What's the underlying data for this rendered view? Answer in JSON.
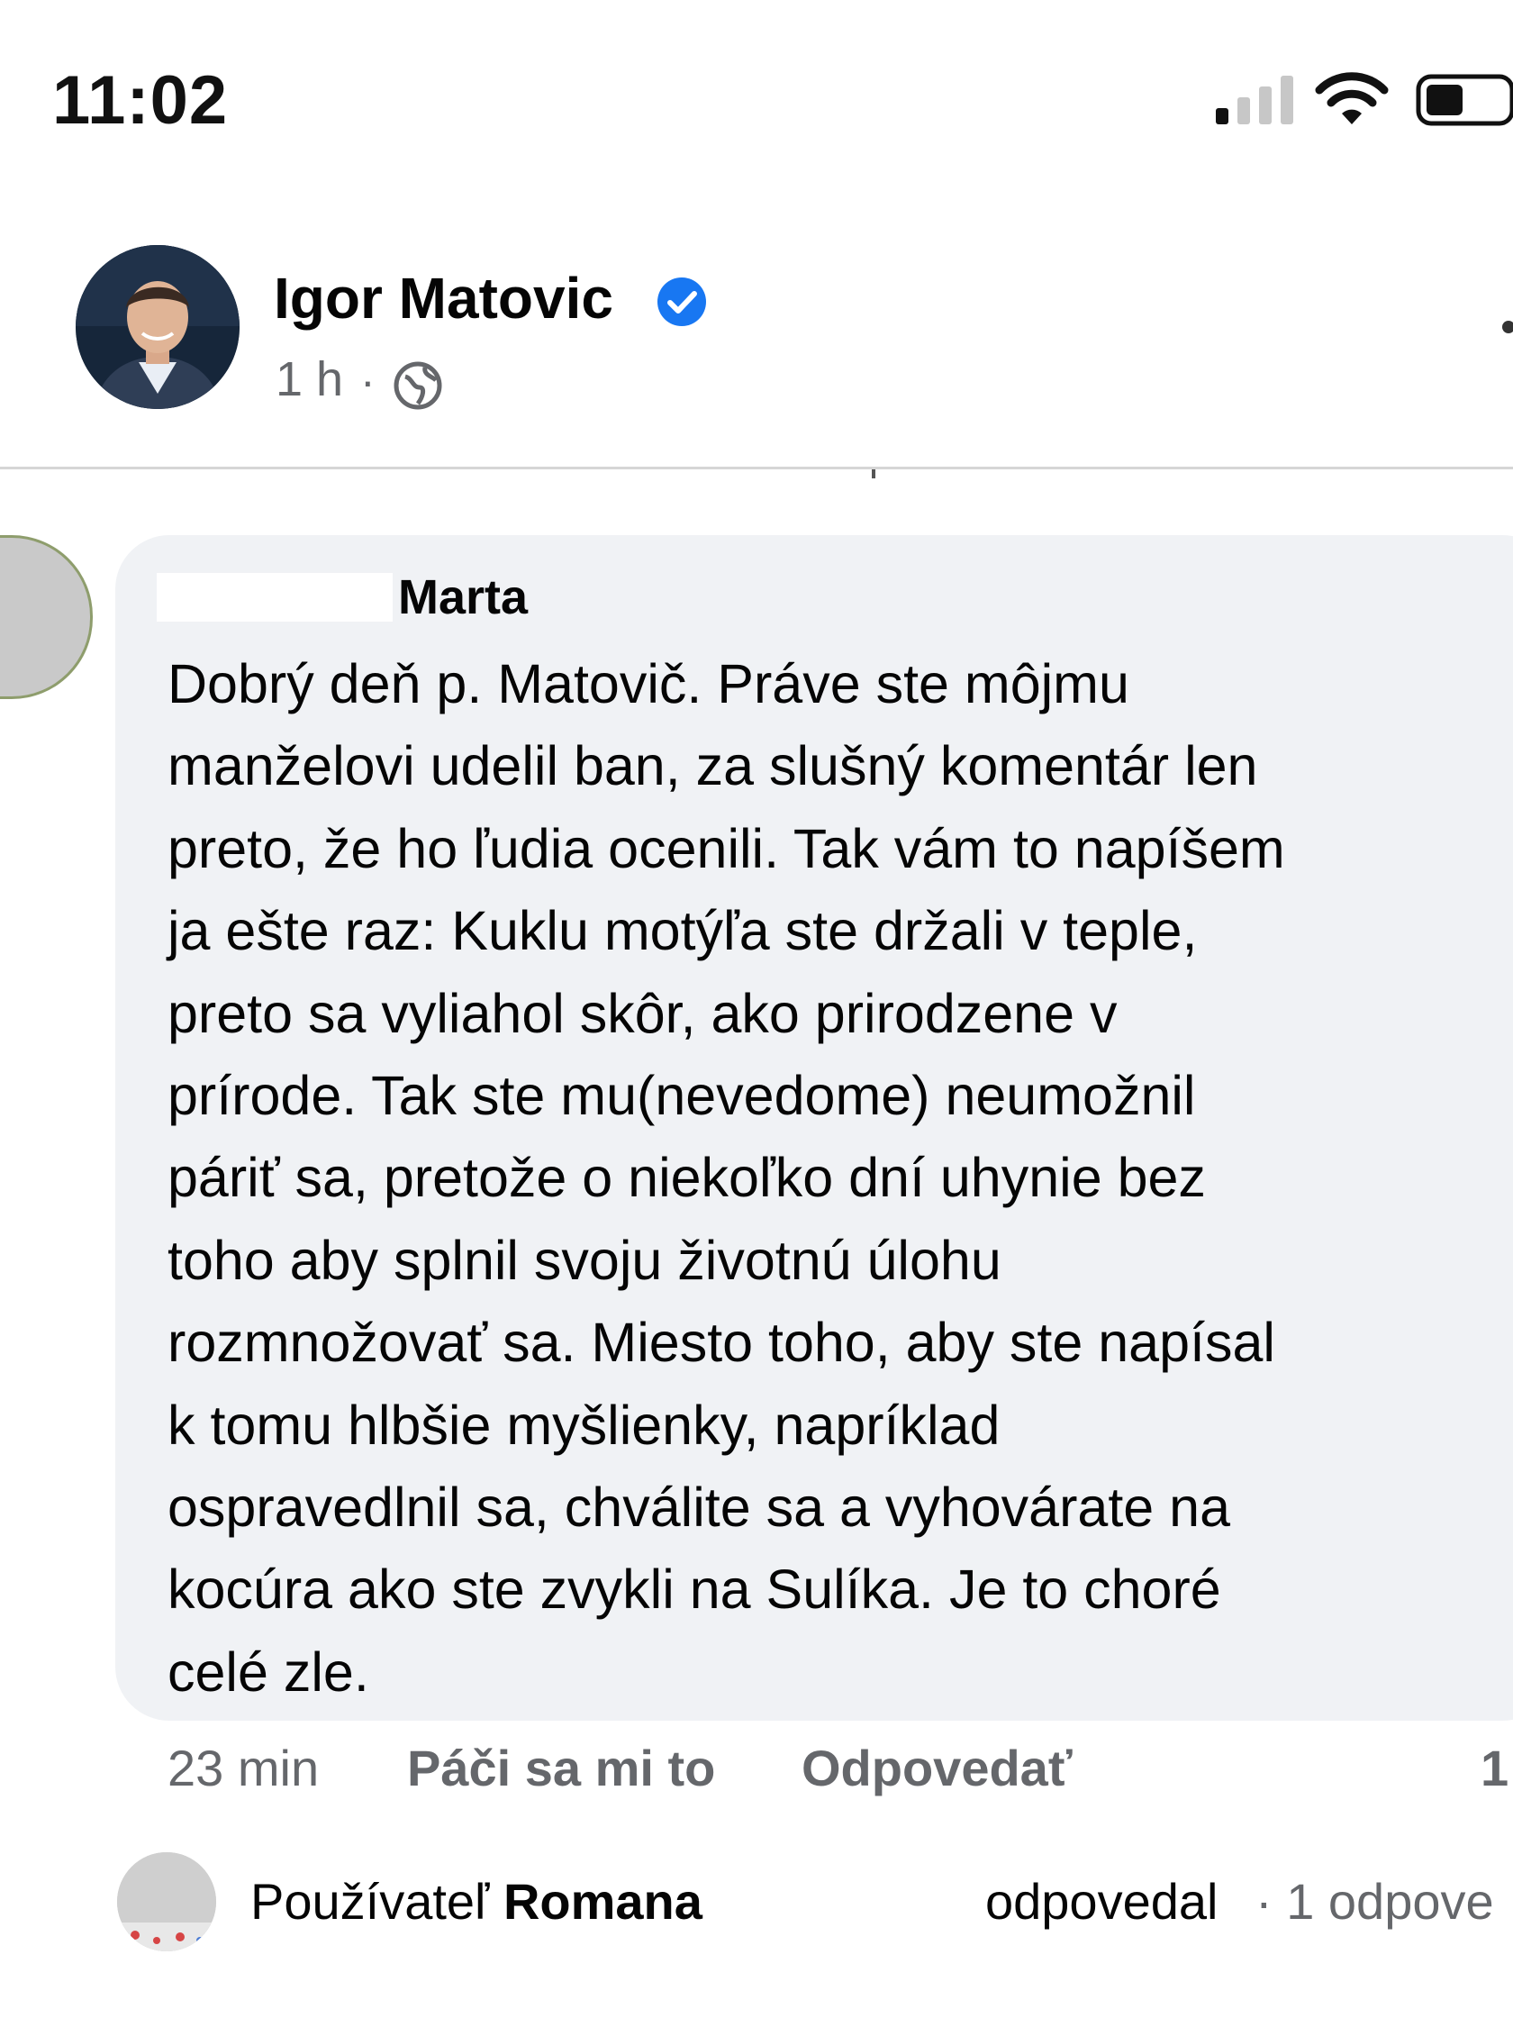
{
  "status_bar": {
    "time": "11:02"
  },
  "post": {
    "author": "Igor Matovic",
    "time": "1 h",
    "separator": "·",
    "icons": [
      "verified-badge-icon",
      "globe-icon"
    ]
  },
  "comment": {
    "author": "Marta",
    "text_lines": [
      "Dobrý deň p. Matovič.  Práve ste môjmu",
      "manželovi udelil ban, za slušný komentár len",
      "preto, že ho ľudia ocenili. Tak vám to napíšem",
      "ja ešte raz: Kuklu motýľa ste držali v teple,",
      "preto sa vyliahol skôr, ako prirodzene v",
      "prírode. Tak ste mu(nevedome) neumožnil",
      "páriť sa, pretože o niekoľko dní uhynie bez",
      "toho aby splnil svoju životnú  úlohu",
      "rozmnožovať sa. Miesto toho, aby ste napísal",
      "k tomu hlbšie myšlienky, napríklad",
      "ospravedlnil sa, chválite sa a vyhovárate na",
      "kocúra ako ste zvykli na Sulíka. Je to choré",
      "celé zle."
    ]
  },
  "actions": {
    "time": "23 min",
    "like": "Páči sa mi to",
    "reply": "Odpovedať",
    "count": "1"
  },
  "reply_summary": {
    "prefix": "Používateľ",
    "user": "Romana",
    "verb": "odpovedal",
    "count": "· 1 odpove"
  },
  "colors": {
    "verified_blue": "#1877f2",
    "secondary_text": "#65676b",
    "bubble_bg": "#f0f2f5"
  }
}
